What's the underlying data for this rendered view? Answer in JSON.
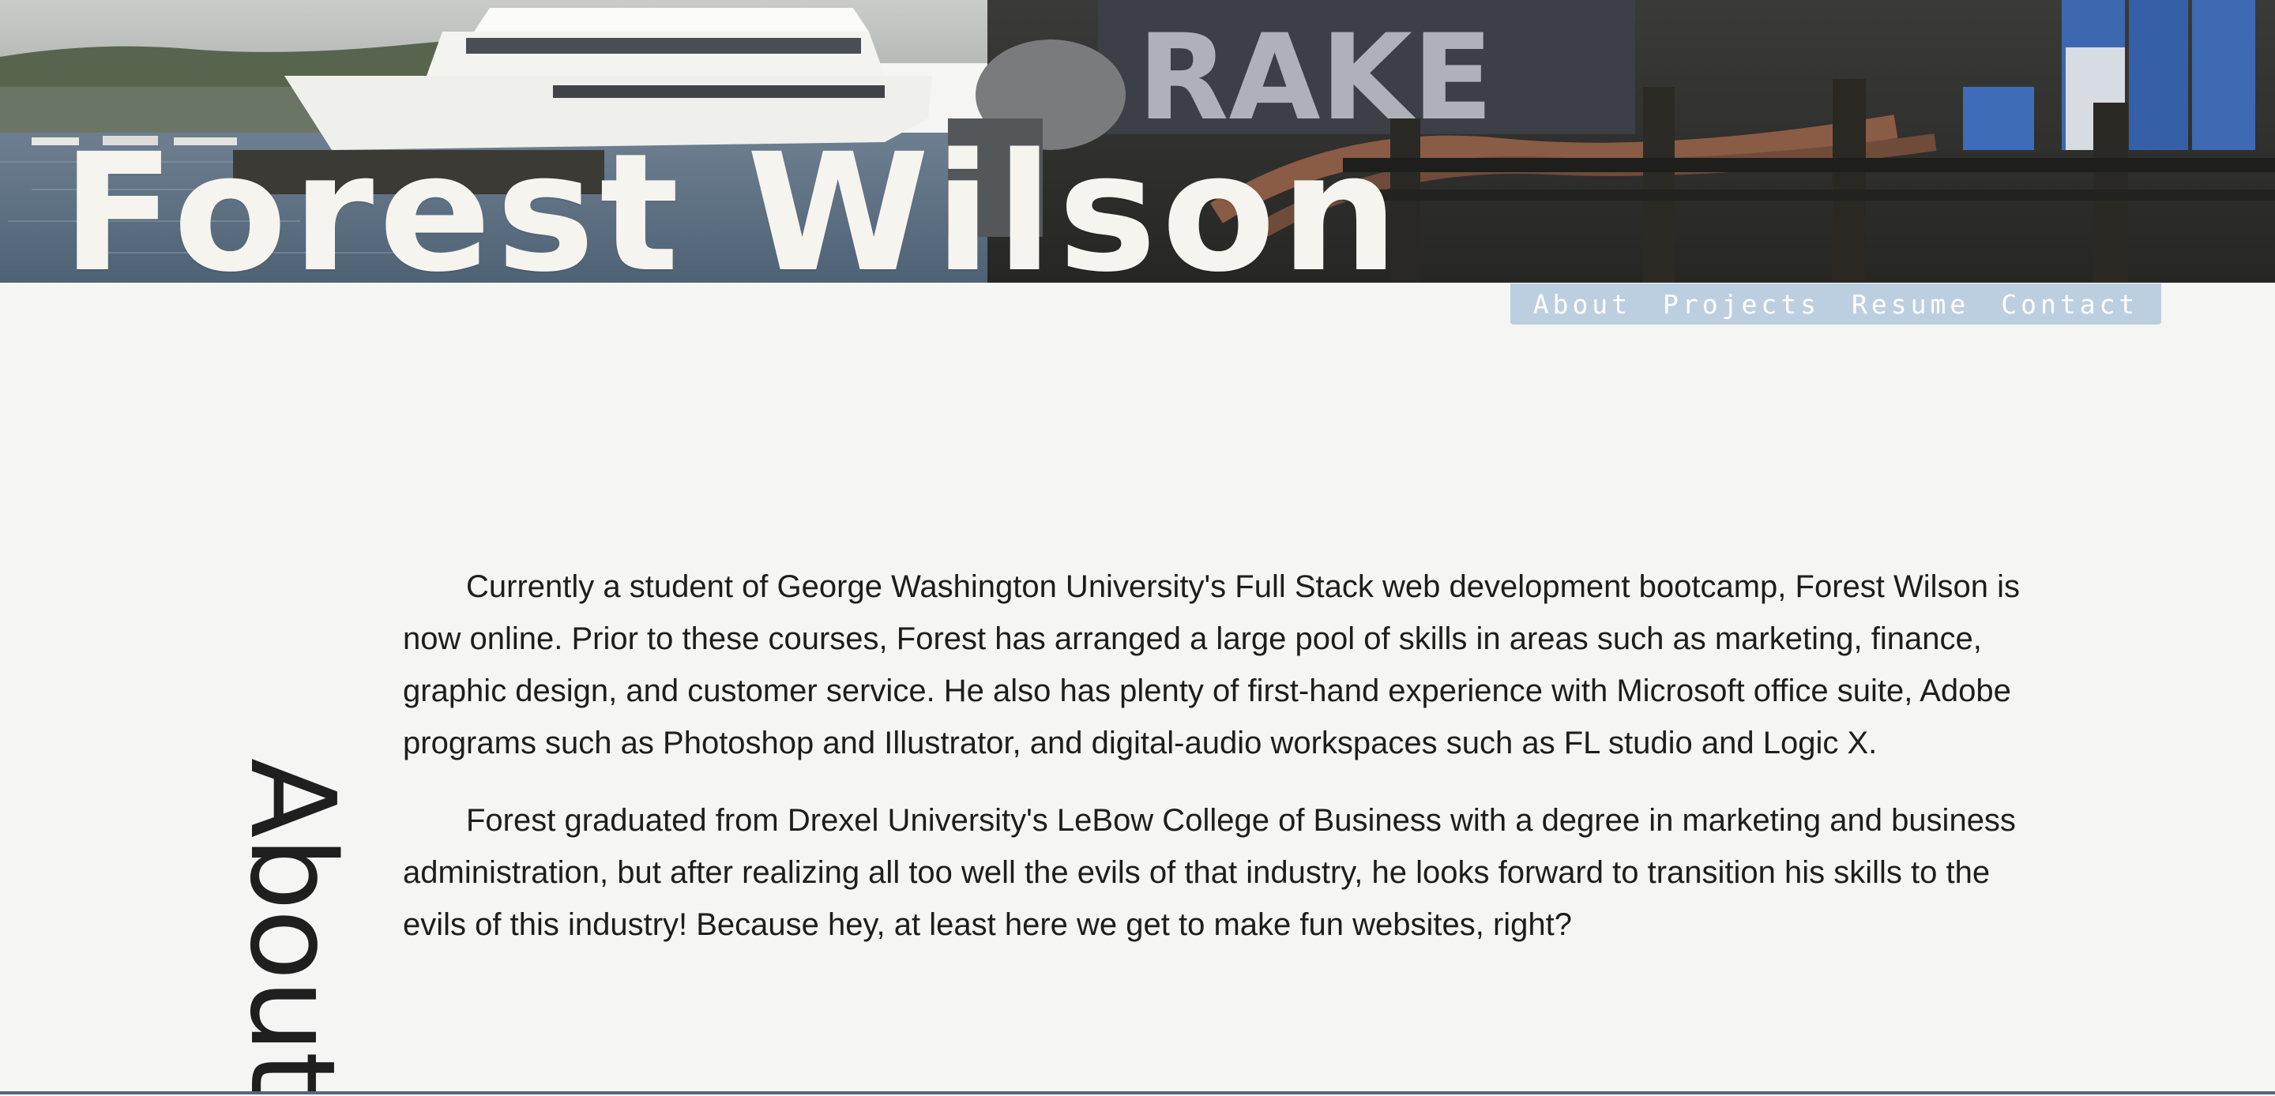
{
  "header": {
    "site_title": "Forest Wilson"
  },
  "nav": {
    "items": [
      {
        "label": "About"
      },
      {
        "label": "Projects"
      },
      {
        "label": "Resume"
      },
      {
        "label": "Contact"
      }
    ]
  },
  "about": {
    "heading": "About",
    "paragraphs": [
      "Currently a student of George Washington University's Full Stack web development bootcamp, Forest Wilson is now online. Prior to these courses, Forest has arranged a large pool of skills in areas such as marketing, finance, graphic design, and customer service. He also has plenty of first-hand experience with Microsoft office suite, Adobe programs such as Photoshop and Illustrator, and digital-audio workspaces such as FL studio and Logic X.",
      "Forest graduated from Drexel University's LeBow College of Business with a degree in marketing and business administration, but after realizing all too well the evils of that industry, he looks forward to transition his skills to the evils of this industry! Because hey, at least here we get to make fun websites, right?"
    ]
  },
  "colors": {
    "page_background": "#f5f5f3",
    "nav_background": "#bccfe1",
    "nav_text": "#ffffff",
    "body_text": "#1d1d1d",
    "title_text": "#f6f4ef"
  },
  "banner_text": {
    "graffiti": "RAKE"
  }
}
